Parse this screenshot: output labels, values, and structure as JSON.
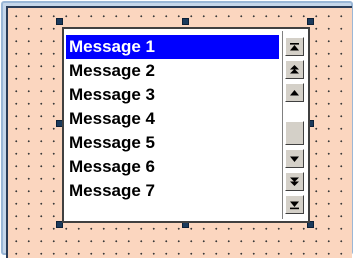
{
  "list": {
    "items": [
      {
        "label": "Message 1",
        "selected": true
      },
      {
        "label": "Message 2",
        "selected": false
      },
      {
        "label": "Message 3",
        "selected": false
      },
      {
        "label": "Message 4",
        "selected": false
      },
      {
        "label": "Message 5",
        "selected": false
      },
      {
        "label": "Message 6",
        "selected": false
      },
      {
        "label": "Message 7",
        "selected": false
      }
    ]
  },
  "scrollbar": {
    "buttons": [
      "scroll-to-top-icon",
      "page-up-icon",
      "line-up-icon",
      "line-down-icon",
      "page-down-icon",
      "scroll-to-bottom-icon"
    ]
  },
  "colors": {
    "canvas": "#fbd6bf",
    "selection": "#0000ff",
    "handle": "#1b3a5c"
  }
}
